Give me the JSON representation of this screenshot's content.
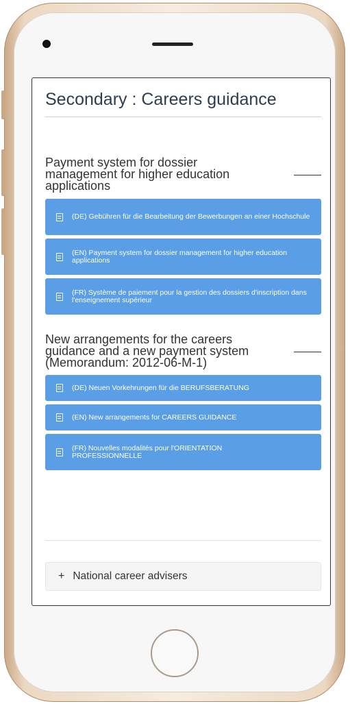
{
  "page": {
    "title": "Secondary : Careers guidance"
  },
  "sections": [
    {
      "heading": "Payment system for dossier management for higher education applications",
      "documents": [
        {
          "label": "(DE) Gebühren für die Bearbeitung der Bewerbungen an einer Hochschule",
          "icon": "document-icon"
        },
        {
          "label": "(EN) Payment system for dossier management for higher education applications",
          "icon": "document-icon"
        },
        {
          "label": "(FR) Système de paiement pour la gestion des dossiers d'inscription dans l'enseignement supérieur",
          "icon": "document-icon"
        }
      ]
    },
    {
      "heading": "New arrangements for the careers guidance and a new payment system (Memorandum: 2012-06-M-1)",
      "documents": [
        {
          "label": "(DE) Neuen Vorkehrungen für die BERUFSBERATUNG",
          "icon": "document-icon"
        },
        {
          "label": "(EN) New arrangements for CAREERS GUIDANCE",
          "icon": "document-icon"
        },
        {
          "label": "(FR) Nouvelles modalités pour l'ORIENTATION PROFESSIONNELLE",
          "icon": "document-icon"
        }
      ]
    }
  ],
  "accordion": {
    "icon": "plus",
    "label": "National career advisers"
  },
  "colors": {
    "button": "#5a9ee6",
    "title": "#2d3e50",
    "phone_frame": "#ecd8c2"
  }
}
